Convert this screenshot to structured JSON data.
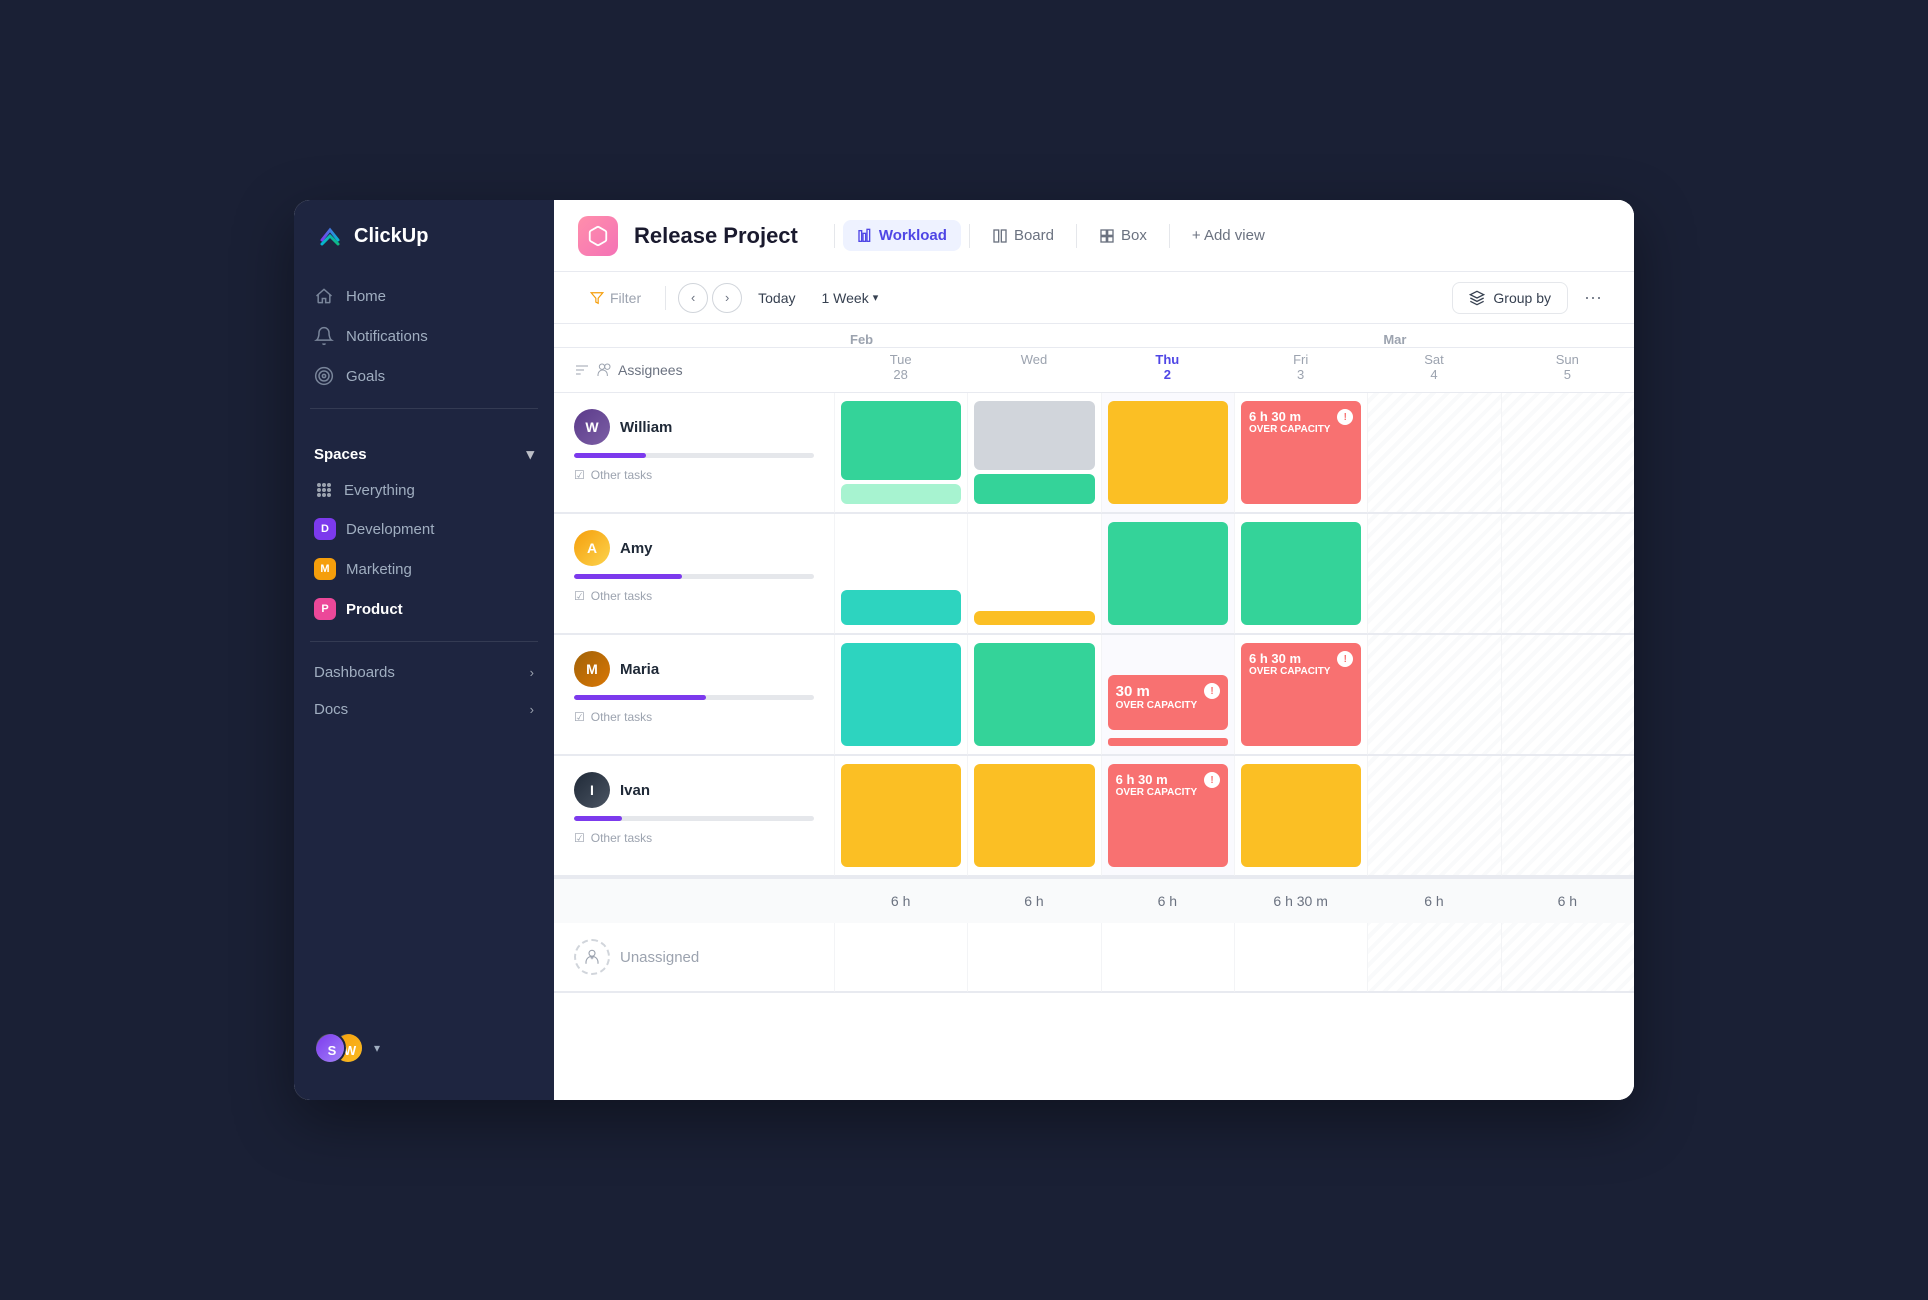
{
  "app": {
    "name": "ClickUp"
  },
  "sidebar": {
    "nav": [
      {
        "id": "home",
        "label": "Home",
        "icon": "home"
      },
      {
        "id": "notifications",
        "label": "Notifications",
        "icon": "bell"
      },
      {
        "id": "goals",
        "label": "Goals",
        "icon": "target"
      }
    ],
    "spaces_label": "Spaces",
    "spaces": [
      {
        "id": "everything",
        "label": "Everything",
        "badge": null,
        "badge_color": null
      },
      {
        "id": "development",
        "label": "Development",
        "badge": "D",
        "badge_color": "#7c3aed"
      },
      {
        "id": "marketing",
        "label": "Marketing",
        "badge": "M",
        "badge_color": "#f59e0b"
      },
      {
        "id": "product",
        "label": "Product",
        "badge": "P",
        "badge_color": "#ec4899",
        "active": true
      }
    ],
    "bottom_nav": [
      {
        "id": "dashboards",
        "label": "Dashboards"
      },
      {
        "id": "docs",
        "label": "Docs"
      }
    ]
  },
  "header": {
    "project_name": "Release Project",
    "views": [
      {
        "id": "workload",
        "label": "Workload",
        "active": true
      },
      {
        "id": "board",
        "label": "Board",
        "active": false
      },
      {
        "id": "box",
        "label": "Box",
        "active": false
      }
    ],
    "add_view_label": "+ Add view"
  },
  "toolbar": {
    "filter_label": "Filter",
    "today_label": "Today",
    "week_label": "1 Week",
    "group_by_label": "Group by"
  },
  "grid": {
    "assignee_header": "Assignees",
    "columns": [
      {
        "month": "Feb",
        "day_name": "Tue",
        "day_num": "28",
        "today": false,
        "weekend": false
      },
      {
        "month": "",
        "day_name": "Wed",
        "day_num": "",
        "today": false,
        "weekend": false
      },
      {
        "month": "",
        "day_name": "Thu",
        "day_num": "2",
        "today": true,
        "weekend": false
      },
      {
        "month": "",
        "day_name": "Fri",
        "day_num": "3",
        "today": false,
        "weekend": false
      },
      {
        "month": "Mar",
        "day_name": "Sat",
        "day_num": "4",
        "today": false,
        "weekend": true
      },
      {
        "month": "",
        "day_name": "Sun",
        "day_num": "5",
        "today": false,
        "weekend": true
      }
    ],
    "persons": [
      {
        "id": "william",
        "name": "William",
        "capacity_pct": 30,
        "av_color": "#6d4c8a",
        "cells": [
          {
            "blocks": [
              {
                "type": "green",
                "size": "large"
              },
              {
                "type": "light-teal",
                "size": "small"
              }
            ],
            "footer_label": ""
          },
          {
            "blocks": [
              {
                "type": "gray",
                "size": "large"
              },
              {
                "type": "green",
                "size": "medium"
              }
            ],
            "footer_label": ""
          },
          {
            "blocks": [
              {
                "type": "orange",
                "size": "medium"
              }
            ],
            "today": true,
            "footer_label": ""
          },
          {
            "blocks": [
              {
                "type": "red",
                "size": "large",
                "time": "6 h 30 m",
                "over": true
              }
            ],
            "footer_label": ""
          },
          {
            "blocks": [],
            "weekend": true,
            "footer_label": ""
          },
          {
            "blocks": [],
            "weekend": true,
            "footer_label": ""
          }
        ]
      },
      {
        "id": "amy",
        "name": "Amy",
        "capacity_pct": 45,
        "av_color": "#d97706",
        "cells": [
          {
            "blocks": [
              {
                "type": "teal",
                "size": "small"
              }
            ],
            "footer_label": ""
          },
          {
            "blocks": [
              {
                "type": "orange",
                "size": "small"
              }
            ],
            "footer_label": ""
          },
          {
            "blocks": [
              {
                "type": "green",
                "size": "large"
              }
            ],
            "today": true,
            "footer_label": ""
          },
          {
            "blocks": [
              {
                "type": "green",
                "size": "large"
              }
            ],
            "footer_label": ""
          },
          {
            "blocks": [],
            "weekend": true,
            "footer_label": ""
          },
          {
            "blocks": [],
            "weekend": true,
            "footer_label": ""
          }
        ]
      },
      {
        "id": "maria",
        "name": "Maria",
        "capacity_pct": 55,
        "av_color": "#10b981",
        "cells": [
          {
            "blocks": [
              {
                "type": "teal",
                "size": "large"
              }
            ],
            "footer_label": ""
          },
          {
            "blocks": [
              {
                "type": "green",
                "size": "large"
              }
            ],
            "footer_label": ""
          },
          {
            "blocks": [
              {
                "type": "red-small",
                "size": "small",
                "time": "30 m",
                "over": true
              }
            ],
            "today": true,
            "footer_label": ""
          },
          {
            "blocks": [
              {
                "type": "red",
                "size": "large",
                "time": "6 h 30 m",
                "over": true
              }
            ],
            "footer_label": ""
          },
          {
            "blocks": [],
            "weekend": true,
            "footer_label": ""
          },
          {
            "blocks": [],
            "weekend": true,
            "footer_label": ""
          }
        ]
      },
      {
        "id": "ivan",
        "name": "Ivan",
        "capacity_pct": 20,
        "av_color": "#7c3aed",
        "cells": [
          {
            "blocks": [
              {
                "type": "orange",
                "size": "large"
              }
            ],
            "footer_label": ""
          },
          {
            "blocks": [
              {
                "type": "orange",
                "size": "large"
              }
            ],
            "footer_label": ""
          },
          {
            "blocks": [
              {
                "type": "red",
                "size": "large",
                "time": "6 h 30 m",
                "over": true
              }
            ],
            "today": true,
            "footer_label": ""
          },
          {
            "blocks": [
              {
                "type": "orange",
                "size": "medium"
              }
            ],
            "footer_label": ""
          },
          {
            "blocks": [],
            "weekend": true,
            "footer_label": ""
          },
          {
            "blocks": [],
            "weekend": true,
            "footer_label": ""
          }
        ]
      }
    ],
    "footer": {
      "cells": [
        "",
        "6 h",
        "6 h",
        "6 h",
        "6 h 30 m",
        "6 h",
        "6 h"
      ]
    },
    "unassigned_label": "Unassigned"
  }
}
